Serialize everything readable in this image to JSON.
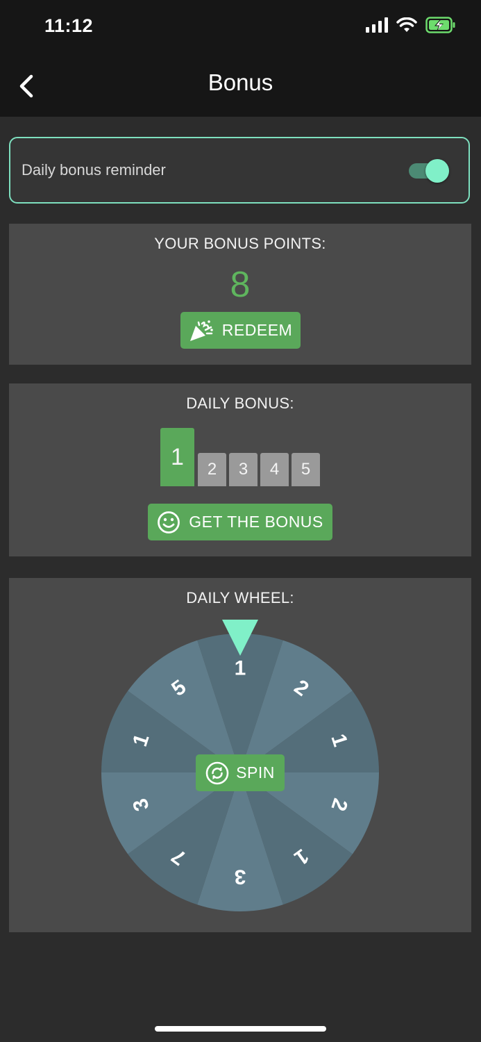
{
  "status": {
    "time": "11:12"
  },
  "nav": {
    "title": "Bonus"
  },
  "reminder": {
    "label": "Daily bonus reminder",
    "enabled": true
  },
  "bonus_points": {
    "title": "YOUR BONUS POINTS:",
    "value": "8",
    "redeem_label": "REDEEM"
  },
  "daily_bonus": {
    "title": "DAILY BONUS:",
    "days": [
      "1",
      "2",
      "3",
      "4",
      "5"
    ],
    "current_day": 1,
    "button_label": "GET THE BONUS"
  },
  "daily_wheel": {
    "title": "DAILY WHEEL:",
    "segments": [
      "1",
      "2",
      "1",
      "2",
      "1",
      "3",
      "7",
      "3",
      "1",
      "5"
    ],
    "spin_label": "SPIN"
  },
  "colors": {
    "accent": "#5aa85a",
    "teal": "#80f0c8",
    "wheel_light": "#607d8b",
    "wheel_dark": "#546e7a",
    "card": "#4a4a4a",
    "background": "#2c2c2c",
    "bar": "#161616"
  }
}
